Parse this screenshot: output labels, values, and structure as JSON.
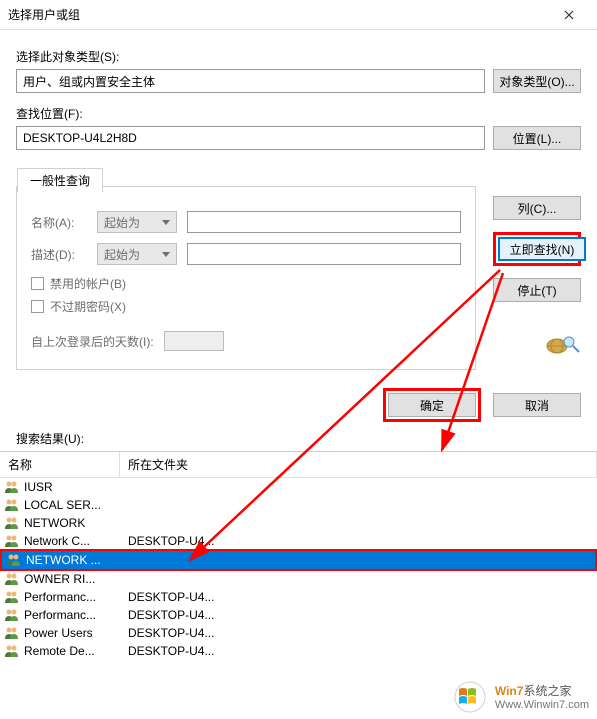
{
  "titlebar": {
    "title": "选择用户或组"
  },
  "objectType": {
    "label": "选择此对象类型(S):",
    "value": "用户、组或内置安全主体",
    "button": "对象类型(O)..."
  },
  "location": {
    "label": "查找位置(F):",
    "value": "DESKTOP-U4L2H8D",
    "button": "位置(L)..."
  },
  "tab": {
    "label": "一般性查询"
  },
  "query": {
    "nameLabel": "名称(A):",
    "nameMode": "起始为",
    "descLabel": "描述(D):",
    "descMode": "起始为",
    "disabledAccounts": "禁用的帐户(B)",
    "nonExpiring": "不过期密码(X)",
    "daysLabel": "自上次登录后的天数(I):"
  },
  "sideButtons": {
    "columns": "列(C)...",
    "findNow": "立即查找(N)",
    "stop": "停止(T)"
  },
  "actions": {
    "ok": "确定",
    "cancel": "取消"
  },
  "results": {
    "label": "搜索结果(U):",
    "colName": "名称",
    "colFolder": "所在文件夹",
    "rows": [
      {
        "name": "IUSR",
        "folder": "",
        "selected": false
      },
      {
        "name": "LOCAL SER...",
        "folder": "",
        "selected": false
      },
      {
        "name": "NETWORK",
        "folder": "",
        "selected": false
      },
      {
        "name": "Network C...",
        "folder": "DESKTOP-U4...",
        "selected": false
      },
      {
        "name": "NETWORK ...",
        "folder": "",
        "selected": true
      },
      {
        "name": "OWNER RI...",
        "folder": "",
        "selected": false
      },
      {
        "name": "Performanc...",
        "folder": "DESKTOP-U4...",
        "selected": false
      },
      {
        "name": "Performanc...",
        "folder": "DESKTOP-U4...",
        "selected": false
      },
      {
        "name": "Power Users",
        "folder": "DESKTOP-U4...",
        "selected": false
      },
      {
        "name": "Remote De...",
        "folder": "DESKTOP-U4...",
        "selected": false
      }
    ]
  },
  "watermark": {
    "brand": "Win7",
    "brandRest": "系统之家",
    "url": "Www.Winwin7.com"
  }
}
